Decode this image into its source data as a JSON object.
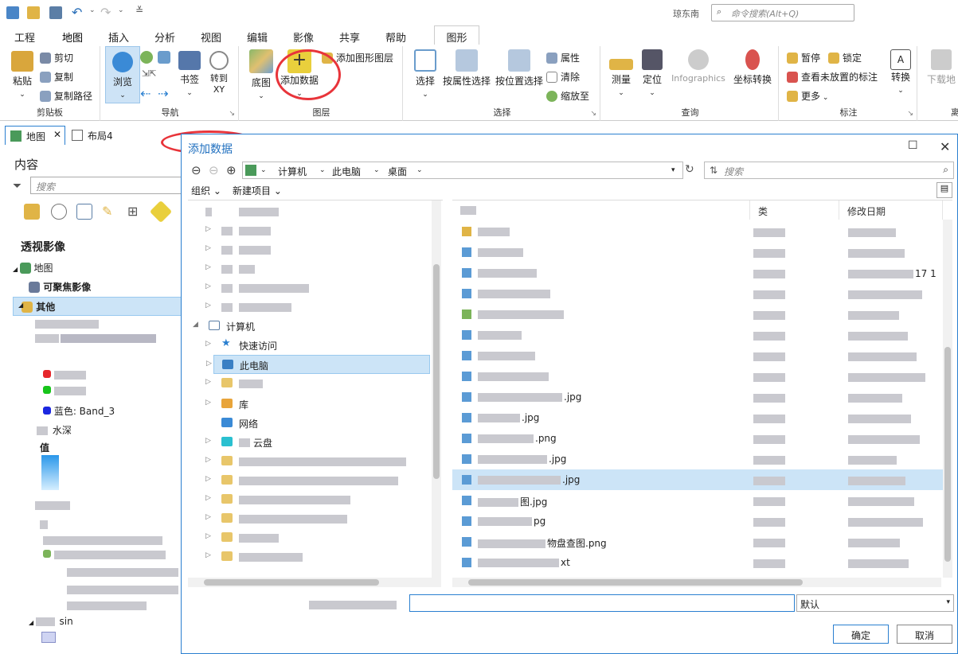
{
  "app": {
    "user": "琼东南",
    "command_search_placeholder": "命令搜索(Alt+Q)"
  },
  "ribbon_tabs": [
    "工程",
    "地图",
    "插入",
    "分析",
    "视图",
    "编辑",
    "影像",
    "共享",
    "帮助"
  ],
  "active_tab": "地图",
  "context_tab": "图形",
  "ribbon": {
    "clipboard": {
      "label": "剪贴板",
      "paste": "粘贴",
      "cut": "剪切",
      "copy": "复制",
      "copy_path": "复制路径"
    },
    "navigate": {
      "label": "导航",
      "explore": "浏览",
      "bookmarks": "书签",
      "goto_xy": "转到\nXY"
    },
    "layer": {
      "label": "图层",
      "basemap": "底图",
      "add_data": "添加数据",
      "add_graphics_layer": "添加图形图层"
    },
    "selection": {
      "label": "选择",
      "select": "选择",
      "by_attributes": "按属性选择",
      "by_location": "按位置选择",
      "attributes": "属性",
      "clear": "清除",
      "zoom_to": "缩放至"
    },
    "inquiry": {
      "label": "查询",
      "measure": "测量",
      "locate": "定位",
      "infographics": "Infographics",
      "coord_convert": "坐标转换"
    },
    "labeling": {
      "label": "标注",
      "pause": "暂停",
      "lock": "锁定",
      "view_unplaced": "查看未放置的标注",
      "more": "更多",
      "convert": "转换"
    },
    "offline": {
      "download": "下载地",
      "label": "离"
    }
  },
  "doc_tabs": [
    "地图",
    "布局4"
  ],
  "contents": {
    "title": "内容",
    "search_placeholder": "搜索",
    "section": "透视影像",
    "map": "地图",
    "focusable": "可聚焦影像",
    "other": "其他",
    "band_label": "蓝色: Band_3",
    "water_depth": "水深",
    "value": "值",
    "tail": "sin"
  },
  "dialog": {
    "title": "添加数据",
    "breadcrumbs": [
      "计算机",
      "此电脑",
      "桌面"
    ],
    "search_placeholder": "搜索",
    "organize": "组织",
    "new_item": "新建项目",
    "nav_items": {
      "computer": "计算机",
      "quick_access": "快速访问",
      "this_pc": "此电脑",
      "library": "库",
      "network": "网络",
      "cloud": "云盘"
    },
    "columns": {
      "name": "",
      "type": "类",
      "modified": "修改日期"
    },
    "files": [
      {
        "name": "",
        "type": "",
        "date": ""
      },
      {
        "name": "",
        "type": "",
        "date": ""
      },
      {
        "name": "",
        "type": "",
        "date": "17 1"
      },
      {
        "name": "",
        "type": "",
        "date": ""
      },
      {
        "name": "",
        "type": "",
        "date": ""
      },
      {
        "name": "",
        "type": "",
        "date": ""
      },
      {
        "name": "",
        "type": "",
        "date": ""
      },
      {
        "name": "",
        "type": "",
        "date": ""
      },
      {
        "name": ".jpg",
        "type": "",
        "date": ""
      },
      {
        "name": ".jpg",
        "type": "",
        "date": ""
      },
      {
        "name": ".png",
        "type": "",
        "date": ""
      },
      {
        "name": ".jpg",
        "type": "",
        "date": ""
      },
      {
        "name": ".jpg",
        "type": "",
        "date": ""
      },
      {
        "name": "图.jpg",
        "type": "",
        "date": ""
      },
      {
        "name": "pg",
        "type": "",
        "date": ""
      },
      {
        "name": "物盘查图.png",
        "type": "",
        "date": ""
      },
      {
        "name": "xt",
        "type": "",
        "date": ""
      }
    ],
    "filter": "默认",
    "ok": "确定",
    "cancel": "取消"
  }
}
